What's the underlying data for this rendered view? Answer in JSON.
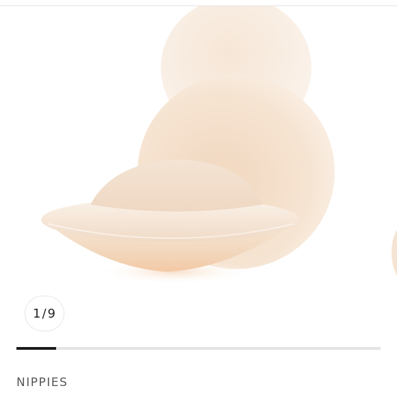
{
  "gallery": {
    "current": "1",
    "separator": "/",
    "total": "9",
    "progress_fraction": 0.109
  },
  "product": {
    "brand": "NIPPIES"
  },
  "colors": {
    "skin_light": "#f8ece1",
    "skin_mid": "#f2dcc6",
    "skin_shadow": "#ecd0b6",
    "progress_fill": "#1a1a1a",
    "progress_track": "#e4e4e4"
  }
}
